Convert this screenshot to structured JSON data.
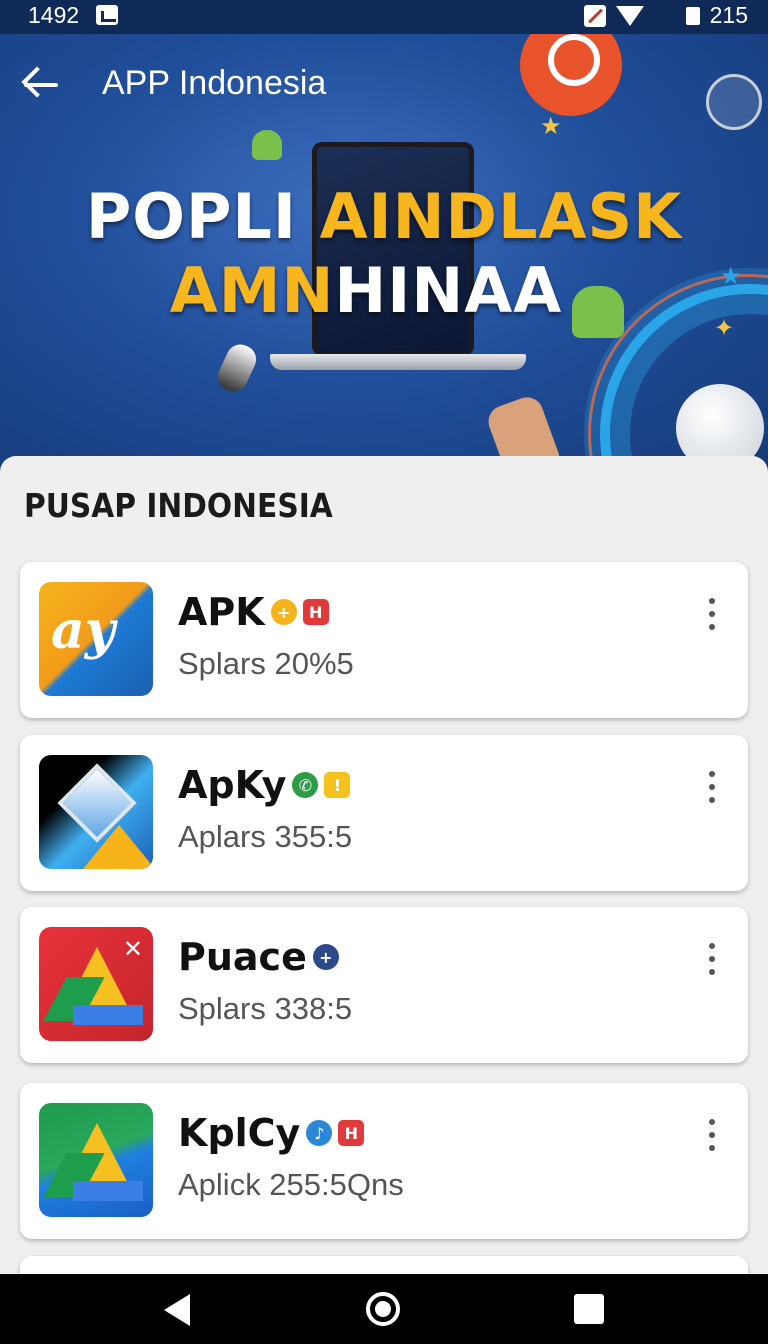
{
  "status_bar": {
    "time": "1492",
    "battery_level": "215",
    "icons": [
      "app-notification-icon",
      "no-signal-icon",
      "wifi-icon",
      "battery-icon"
    ]
  },
  "header": {
    "title": "APP Indonesia",
    "back_icon": "arrow-left-icon"
  },
  "hero": {
    "line1_white": "POPLI ",
    "line1_yellow": "AINDLASK",
    "line2_yellow": "AMN",
    "line2_white": "HINAA",
    "colors": {
      "white": "#ffffff",
      "yellow": "#f7b51e",
      "background": "#214f9b"
    }
  },
  "section": {
    "title": "PUSAP INDONESIA"
  },
  "apps": [
    {
      "name": "APK",
      "subtitle": "Splars 20%5",
      "icon": "apk-app-icon",
      "icon_glyph": "ay",
      "badges": [
        {
          "icon": "plus-icon",
          "glyph": "+",
          "color": "#f5b31c"
        },
        {
          "icon": "h-icon",
          "glyph": "H",
          "color": "#e13a3a"
        }
      ]
    },
    {
      "name": "ApKy",
      "subtitle": "Aplars 355:5",
      "icon": "apky-app-icon",
      "badges": [
        {
          "icon": "phone-icon",
          "glyph": "✆",
          "color": "#2e9b46"
        },
        {
          "icon": "lock-icon",
          "glyph": "!",
          "color": "#f5c21c"
        }
      ]
    },
    {
      "name": "Puace",
      "subtitle": "Splars 338:5",
      "icon": "puace-app-icon",
      "close_glyph": "✕",
      "badges": [
        {
          "icon": "plus-icon",
          "glyph": "+",
          "color": "#2c4a8a"
        }
      ]
    },
    {
      "name": "KplCy",
      "subtitle": "Aplick 255:5Qns",
      "icon": "kplcy-app-icon",
      "badges": [
        {
          "icon": "music-icon",
          "glyph": "♪",
          "color": "#2b88d6"
        },
        {
          "icon": "h-icon",
          "glyph": "H",
          "color": "#e13a3a"
        }
      ]
    }
  ],
  "nav": {
    "back": "nav-back-icon",
    "home": "nav-home-icon",
    "recents": "nav-recents-icon"
  }
}
